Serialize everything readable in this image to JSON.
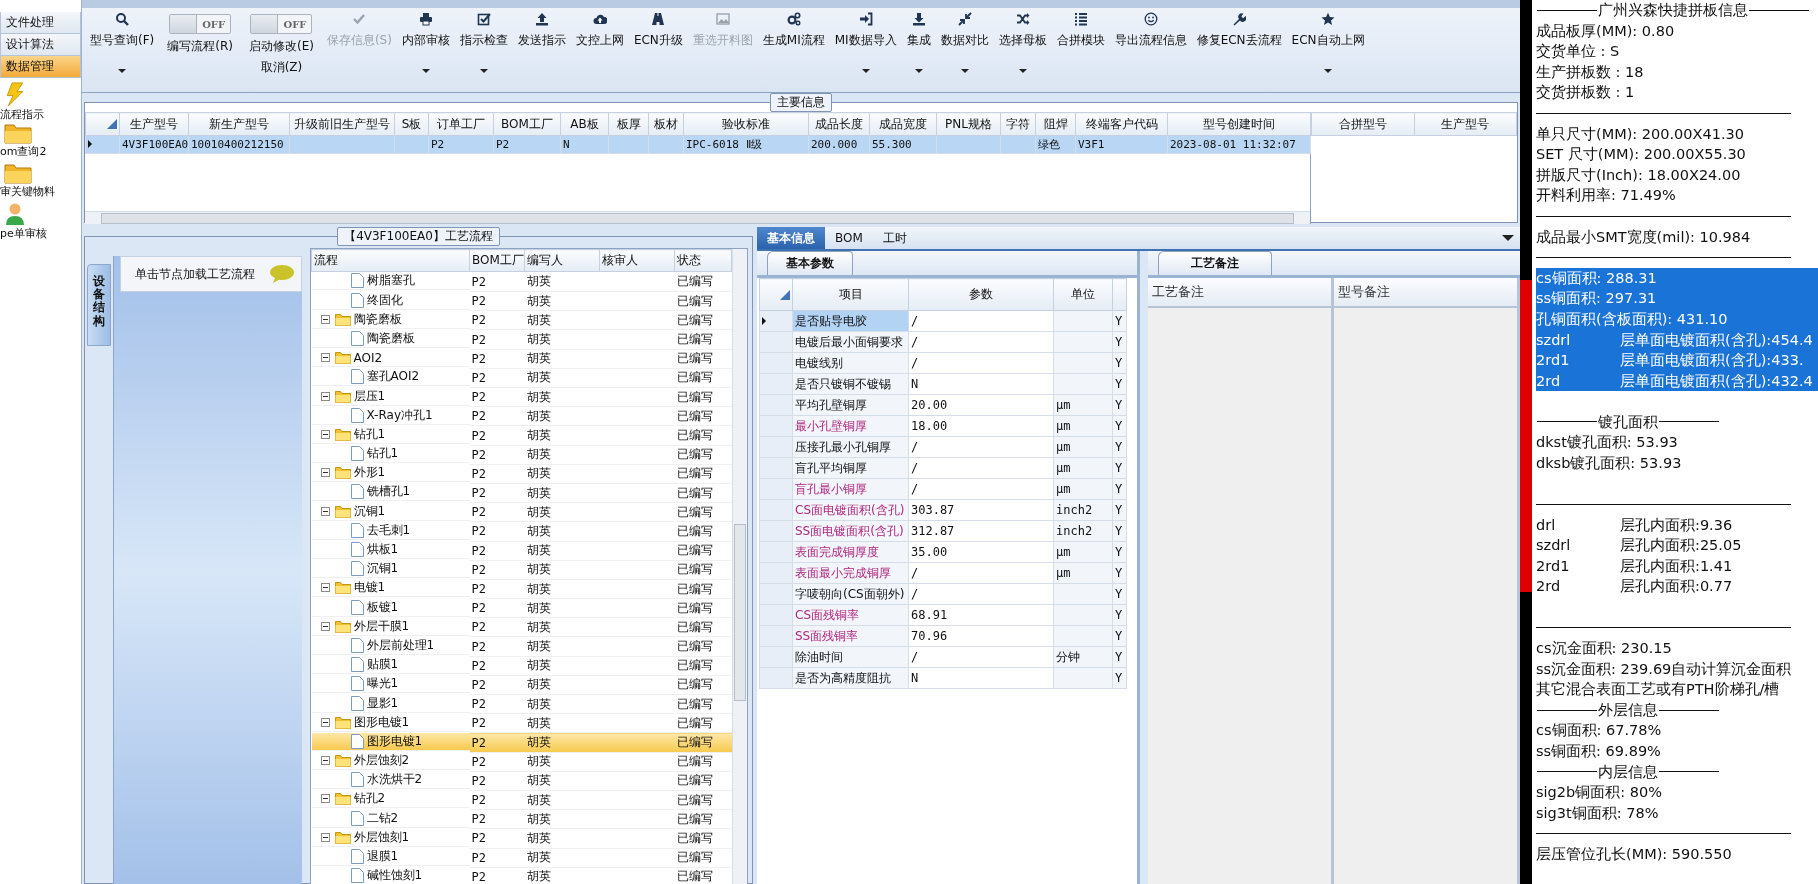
{
  "nav": {
    "menu": [
      {
        "label": "文件处理",
        "selected": false
      },
      {
        "label": "设计算法",
        "selected": false
      },
      {
        "label": "数据管理",
        "selected": true
      }
    ],
    "shortcuts": [
      {
        "label": "流程指示"
      },
      {
        "label": "om查询2"
      },
      {
        "label": "审关键物料"
      },
      {
        "label": "pe单审核"
      }
    ]
  },
  "toolbar": {
    "items": [
      {
        "kind": "button",
        "label": "型号查询(F)",
        "dropdown": true,
        "disabled": false
      },
      {
        "kind": "toggle",
        "label": "编写流程(R)",
        "switch_text": "OFF",
        "on": false
      },
      {
        "kind": "toggle",
        "label": "启动修改(E)",
        "sub_label": "取消(Z)",
        "switch_text": "OFF",
        "on": false
      },
      {
        "kind": "button",
        "label": "保存信息(S)",
        "dropdown": false,
        "disabled": true
      },
      {
        "kind": "button",
        "label": "内部审核",
        "dropdown": true,
        "disabled": false
      },
      {
        "kind": "button",
        "label": "指示检查",
        "dropdown": true,
        "disabled": false
      },
      {
        "kind": "button",
        "label": "发送指示",
        "dropdown": false,
        "disabled": false
      },
      {
        "kind": "button",
        "label": "文控上网",
        "dropdown": false,
        "disabled": false
      },
      {
        "kind": "button",
        "label": "ECN升级",
        "dropdown": false,
        "disabled": false
      },
      {
        "kind": "button",
        "label": "重选开料图",
        "dropdown": false,
        "disabled": true
      },
      {
        "kind": "button",
        "label": "生成MI流程",
        "dropdown": false,
        "disabled": false
      },
      {
        "kind": "button",
        "label": "MI数据导入",
        "dropdown": true,
        "disabled": false
      },
      {
        "kind": "button",
        "label": "集成",
        "dropdown": true,
        "disabled": false
      },
      {
        "kind": "button",
        "label": "数据对比",
        "dropdown": true,
        "disabled": false
      },
      {
        "kind": "button",
        "label": "选择母板",
        "dropdown": true,
        "disabled": false
      },
      {
        "kind": "button",
        "label": "合拼模块",
        "dropdown": false,
        "disabled": false
      },
      {
        "kind": "button",
        "label": "导出流程信息",
        "dropdown": false,
        "disabled": false
      },
      {
        "kind": "button",
        "label": "修复ECN丢流程",
        "dropdown": false,
        "disabled": false
      },
      {
        "kind": "button",
        "label": "ECN自动上网",
        "dropdown": true,
        "disabled": false
      }
    ]
  },
  "main_info": {
    "title": "主要信息",
    "columns": [
      "生产型号",
      "新生产型号",
      "升级前旧生产型号",
      "S板",
      "订单工厂",
      "BOM工厂",
      "AB板",
      "板厚",
      "板材",
      "验收标准",
      "成品长度",
      "成品宽度",
      "PNL规格",
      "字符",
      "阻焊",
      "终端客户代码",
      "型号创建时间"
    ],
    "rows": [
      {
        "selected": true,
        "cells": [
          "4V3F100EA0",
          "10010400212150",
          null,
          null,
          "P2",
          "P2",
          "N",
          null,
          null,
          "IPC-6018 Ⅱ级",
          "200.000",
          "55.300",
          null,
          null,
          "绿色",
          "V3F1",
          "2023-08-01 11:32:07"
        ]
      }
    ],
    "side_columns": [
      "合拼型号",
      "生产型号"
    ]
  },
  "flow": {
    "title": "【4V3F100EA0】工艺流程",
    "side_tab": "设备结构",
    "hint": "单击节点加载工艺流程",
    "columns": [
      "流程",
      "BOM工厂",
      "编写人",
      "核审人",
      "状态"
    ],
    "nodes": [
      {
        "kind": "step",
        "name": "树脂塞孔",
        "bom": "P2",
        "writer": "胡英",
        "status": "已编写",
        "selected": false
      },
      {
        "kind": "step",
        "name": "终固化",
        "bom": "P2",
        "writer": "胡英",
        "status": "已编写",
        "selected": false
      },
      {
        "kind": "group",
        "name": "陶瓷磨板",
        "bom": "P2",
        "writer": "胡英",
        "status": "已编写",
        "selected": false,
        "expanded": true,
        "children": [
          {
            "kind": "step",
            "name": "陶瓷磨板",
            "bom": "P2",
            "writer": "胡英",
            "status": "已编写",
            "selected": false
          }
        ]
      },
      {
        "kind": "group",
        "name": "AOI2",
        "bom": "P2",
        "writer": "胡英",
        "status": "已编写",
        "selected": false,
        "expanded": true,
        "children": [
          {
            "kind": "step",
            "name": "塞孔AOI2",
            "bom": "P2",
            "writer": "胡英",
            "status": "已编写",
            "selected": false
          }
        ]
      },
      {
        "kind": "group",
        "name": "层压1",
        "bom": "P2",
        "writer": "胡英",
        "status": "已编写",
        "selected": false,
        "expanded": true,
        "children": [
          {
            "kind": "step",
            "name": "X-Ray冲孔1",
            "bom": "P2",
            "writer": "胡英",
            "status": "已编写",
            "selected": false
          }
        ]
      },
      {
        "kind": "group",
        "name": "钻孔1",
        "bom": "P2",
        "writer": "胡英",
        "status": "已编写",
        "selected": false,
        "expanded": true,
        "children": [
          {
            "kind": "step",
            "name": "钻孔1",
            "bom": "P2",
            "writer": "胡英",
            "status": "已编写",
            "selected": false
          }
        ]
      },
      {
        "kind": "group",
        "name": "外形1",
        "bom": "P2",
        "writer": "胡英",
        "status": "已编写",
        "selected": false,
        "expanded": true,
        "children": [
          {
            "kind": "step",
            "name": "铣槽孔1",
            "bom": "P2",
            "writer": "胡英",
            "status": "已编写",
            "selected": false
          }
        ]
      },
      {
        "kind": "group",
        "name": "沉铜1",
        "bom": "P2",
        "writer": "胡英",
        "status": "已编写",
        "selected": false,
        "expanded": true,
        "children": [
          {
            "kind": "step",
            "name": "去毛刺1",
            "bom": "P2",
            "writer": "胡英",
            "status": "已编写",
            "selected": false
          },
          {
            "kind": "step",
            "name": "烘板1",
            "bom": "P2",
            "writer": "胡英",
            "status": "已编写",
            "selected": false
          },
          {
            "kind": "step",
            "name": "沉铜1",
            "bom": "P2",
            "writer": "胡英",
            "status": "已编写",
            "selected": false
          }
        ]
      },
      {
        "kind": "group",
        "name": "电镀1",
        "bom": "P2",
        "writer": "胡英",
        "status": "已编写",
        "selected": false,
        "expanded": true,
        "children": [
          {
            "kind": "step",
            "name": "板镀1",
            "bom": "P2",
            "writer": "胡英",
            "status": "已编写",
            "selected": false
          }
        ]
      },
      {
        "kind": "group",
        "name": "外层干膜1",
        "bom": "P2",
        "writer": "胡英",
        "status": "已编写",
        "selected": false,
        "expanded": true,
        "children": [
          {
            "kind": "step",
            "name": "外层前处理1",
            "bom": "P2",
            "writer": "胡英",
            "status": "已编写",
            "selected": false
          },
          {
            "kind": "step",
            "name": "贴膜1",
            "bom": "P2",
            "writer": "胡英",
            "status": "已编写",
            "selected": false
          },
          {
            "kind": "step",
            "name": "曝光1",
            "bom": "P2",
            "writer": "胡英",
            "status": "已编写",
            "selected": false
          },
          {
            "kind": "step",
            "name": "显影1",
            "bom": "P2",
            "writer": "胡英",
            "status": "已编写",
            "selected": false
          }
        ]
      },
      {
        "kind": "group",
        "name": "图形电镀1",
        "bom": "P2",
        "writer": "胡英",
        "status": "已编写",
        "selected": false,
        "expanded": true,
        "children": [
          {
            "kind": "step",
            "name": "图形电镀1",
            "bom": "P2",
            "writer": "胡英",
            "status": "已编写",
            "selected": true
          }
        ]
      },
      {
        "kind": "group",
        "name": "外层蚀刻2",
        "bom": "P2",
        "writer": "胡英",
        "status": "已编写",
        "selected": false,
        "expanded": true,
        "children": [
          {
            "kind": "step",
            "name": "水洗烘干2",
            "bom": "P2",
            "writer": "胡英",
            "status": "已编写",
            "selected": false
          }
        ]
      },
      {
        "kind": "group",
        "name": "钻孔2",
        "bom": "P2",
        "writer": "胡英",
        "status": "已编写",
        "selected": false,
        "expanded": true,
        "children": [
          {
            "kind": "step",
            "name": "二钻2",
            "bom": "P2",
            "writer": "胡英",
            "status": "已编写",
            "selected": false
          }
        ]
      },
      {
        "kind": "group",
        "name": "外层蚀刻1",
        "bom": "P2",
        "writer": "胡英",
        "status": "已编写",
        "selected": false,
        "expanded": true,
        "children": [
          {
            "kind": "step",
            "name": "退膜1",
            "bom": "P2",
            "writer": "胡英",
            "status": "已编写",
            "selected": false
          },
          {
            "kind": "step",
            "name": "碱性蚀刻1",
            "bom": "P2",
            "writer": "胡英",
            "status": "已编写",
            "selected": false
          }
        ]
      }
    ]
  },
  "detail": {
    "tabs": [
      {
        "label": "基本信息",
        "selected": true
      },
      {
        "label": "BOM",
        "selected": false
      },
      {
        "label": "工时",
        "selected": false
      }
    ],
    "sub_tab": "基本参数",
    "columns": [
      "项目",
      "参数",
      "单位"
    ],
    "rows": [
      {
        "item": "是否贴导电胶",
        "value": "/",
        "unit": null,
        "flag": "Y",
        "highlighted": false,
        "selected": true
      },
      {
        "item": "电镀后最小面铜要求",
        "value": "/",
        "unit": null,
        "flag": "Y",
        "highlighted": false,
        "selected": false
      },
      {
        "item": "电镀线别",
        "value": "/",
        "unit": null,
        "flag": "Y",
        "highlighted": false,
        "selected": false
      },
      {
        "item": "是否只镀铜不镀锡",
        "value": "N",
        "unit": null,
        "flag": "Y",
        "highlighted": false,
        "selected": false
      },
      {
        "item": "平均孔壁铜厚",
        "value": "20.00",
        "unit": "μm",
        "flag": "Y",
        "highlighted": false,
        "selected": false
      },
      {
        "item": "最小孔壁铜厚",
        "value": "18.00",
        "unit": "μm",
        "flag": "Y",
        "highlighted": true,
        "selected": false
      },
      {
        "item": "压接孔最小孔铜厚",
        "value": "/",
        "unit": "μm",
        "flag": "Y",
        "highlighted": false,
        "selected": false
      },
      {
        "item": "盲孔平均铜厚",
        "value": "/",
        "unit": "μm",
        "flag": "Y",
        "highlighted": false,
        "selected": false
      },
      {
        "item": "盲孔最小铜厚",
        "value": "/",
        "unit": "μm",
        "flag": "Y",
        "highlighted": true,
        "selected": false
      },
      {
        "item": "CS面电镀面积(含孔)",
        "value": "303.87",
        "unit": "inch2",
        "flag": "Y",
        "highlighted": true,
        "selected": false
      },
      {
        "item": "SS面电镀面积(含孔)",
        "value": "312.87",
        "unit": "inch2",
        "flag": "Y",
        "highlighted": true,
        "selected": false
      },
      {
        "item": "表面完成铜厚度",
        "value": "35.00",
        "unit": "μm",
        "flag": "Y",
        "highlighted": true,
        "selected": false
      },
      {
        "item": "表面最小完成铜厚",
        "value": "/",
        "unit": "μm",
        "flag": "Y",
        "highlighted": true,
        "selected": false
      },
      {
        "item": "字唛朝向(CS面朝外)",
        "value": "/",
        "unit": null,
        "flag": "Y",
        "highlighted": false,
        "selected": false
      },
      {
        "item": "CS面残铜率",
        "value": "68.91",
        "unit": null,
        "flag": "Y",
        "highlighted": true,
        "selected": false
      },
      {
        "item": "SS面残铜率",
        "value": "70.96",
        "unit": null,
        "flag": "Y",
        "highlighted": true,
        "selected": false
      },
      {
        "item": "除油时间",
        "value": "/",
        "unit": "分钟",
        "flag": "Y",
        "highlighted": false,
        "selected": false
      },
      {
        "item": "是否为高精度阻抗",
        "value": "N",
        "unit": null,
        "flag": "Y",
        "highlighted": false,
        "selected": false
      }
    ],
    "notes_tab": "工艺备注",
    "notes_columns": [
      "工艺备注",
      "型号备注"
    ]
  },
  "summary": {
    "lines": [
      {
        "kind": "title",
        "text": "广州兴森快捷拼板信息"
      },
      {
        "kind": "text",
        "text": "成品板厚(MM): 0.80",
        "selected": false
      },
      {
        "kind": "text",
        "text": "交货单位 : S",
        "selected": false
      },
      {
        "kind": "text",
        "text": "生产拼板数 : 18",
        "selected": false
      },
      {
        "kind": "text",
        "text": "交货拼板数 : 1",
        "selected": false
      },
      {
        "kind": "rule"
      },
      {
        "kind": "text",
        "text": "单只尺寸(MM): 200.00X41.30",
        "selected": false
      },
      {
        "kind": "text",
        "text": "SET 尺寸(MM): 200.00X55.30",
        "selected": false
      },
      {
        "kind": "text",
        "text": "拼版尺寸(Inch): 18.00X24.00",
        "selected": false
      },
      {
        "kind": "text",
        "text": "开料利用率: 71.49%",
        "selected": false
      },
      {
        "kind": "rule"
      },
      {
        "kind": "text",
        "text": "成品最小SMT宽度(mil): 10.984",
        "selected": false
      },
      {
        "kind": "rule"
      },
      {
        "kind": "text",
        "text": "cs铜面积: 288.31",
        "selected": true
      },
      {
        "kind": "text",
        "text": "ss铜面积: 297.31",
        "selected": true
      },
      {
        "kind": "text",
        "text": "孔铜面积(含板面积): 431.10",
        "selected": true
      },
      {
        "kind": "pair",
        "left": "szdrl",
        "text": "层单面电镀面积(含孔):454.4",
        "selected": true
      },
      {
        "kind": "pair",
        "left": "2rd1",
        "text": "层单面电镀面积(含孔):433.",
        "selected": true
      },
      {
        "kind": "pair",
        "left": "2rd",
        "text": "层单面电镀面积(含孔):432.4",
        "selected": true
      },
      {
        "kind": "title",
        "text": "镀孔面积",
        "space_before": true
      },
      {
        "kind": "text",
        "text": "dkst镀孔面积: 53.93",
        "selected": false
      },
      {
        "kind": "text",
        "text": "dksb镀孔面积: 53.93",
        "selected": false
      },
      {
        "kind": "rule",
        "space_before": true
      },
      {
        "kind": "pair",
        "left": "drl",
        "text": "层孔内面积:9.36",
        "selected": false
      },
      {
        "kind": "pair",
        "left": "szdrl",
        "text": "层孔内面积:25.05",
        "selected": false
      },
      {
        "kind": "pair",
        "left": "2rd1",
        "text": "层孔内面积:1.41",
        "selected": false
      },
      {
        "kind": "pair",
        "left": "2rd",
        "text": "层孔内面积:0.77",
        "selected": false
      },
      {
        "kind": "rule",
        "space_before": true
      },
      {
        "kind": "text",
        "text": "cs沉金面积: 230.15",
        "selected": false
      },
      {
        "kind": "text",
        "text": "ss沉金面积: 239.69自动计算沉金面积",
        "selected": false
      },
      {
        "kind": "text",
        "text": "其它混合表面工艺或有PTH阶梯孔/槽",
        "selected": false
      },
      {
        "kind": "title",
        "text": "外层信息"
      },
      {
        "kind": "text",
        "text": "cs铜面积: 67.78%",
        "selected": false
      },
      {
        "kind": "text",
        "text": "ss铜面积: 69.89%",
        "selected": false
      },
      {
        "kind": "title",
        "text": "内层信息"
      },
      {
        "kind": "text",
        "text": "sig2b铜面积: 80%",
        "selected": false
      },
      {
        "kind": "text",
        "text": "sig3t铜面积: 78%",
        "selected": false
      },
      {
        "kind": "rule"
      },
      {
        "kind": "text",
        "text": "层压管位孔长(MM): 590.550",
        "selected": false
      }
    ]
  }
}
